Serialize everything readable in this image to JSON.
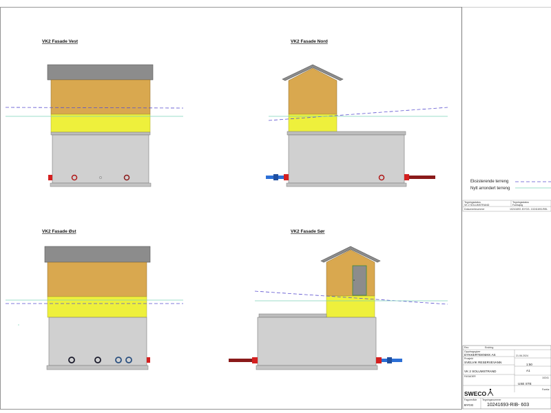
{
  "views": {
    "vest": {
      "title": "VK2 Fasade Vest"
    },
    "nord": {
      "title": "VK2 Fasade Nord"
    },
    "ost": {
      "title": "VK2 Fasade Øst"
    },
    "sor": {
      "title": "VK2 Fasade Sør"
    }
  },
  "legend": {
    "existing_label": "Eksisterende terreng",
    "new_label": "Nytt arrondert terreng"
  },
  "reference": {
    "label_a": "Tegningsstatus",
    "value_a": "VK 2 SOLUMSTRAND",
    "label_b": "Tegningsstatus",
    "value_b": "Foreløpig",
    "label_c": "Dokumentnummer",
    "value_c": "10241693 -BYGG- 10241693-RIB-"
  },
  "title_block": {
    "rev_label": "Rev",
    "endring_label": "Endring",
    "client_label": "Oppdragsgiver",
    "client": "DYKKERTEKNIKK AS",
    "project_label": "Prosjekt",
    "project": "SVELVIK RESERVEVANN",
    "location": "VK 2 SOLUMSTRAND",
    "drawing": "FASADER",
    "date": "21.06.2024",
    "scale": "1:50",
    "format": "A1",
    "doc_short": "10241",
    "status": "USE STE",
    "status2": "Forelø",
    "company": "SWECO",
    "discipline_label": "Fagområde",
    "discipline": "BYGG",
    "drawing_no_label": "Tegningsnummer",
    "drawing_no": "10241693-RIB- 603"
  },
  "colors": {
    "roof": "#8c8c8c",
    "wood": "#d9a84f",
    "yellow_band": "#eef03c",
    "concrete": "#d0d0d0",
    "existing_line": "#5a4fcf",
    "new_line": "#7ad3b8",
    "pipe_red": "#d42020",
    "pipe_blue": "#2c6fd6"
  }
}
